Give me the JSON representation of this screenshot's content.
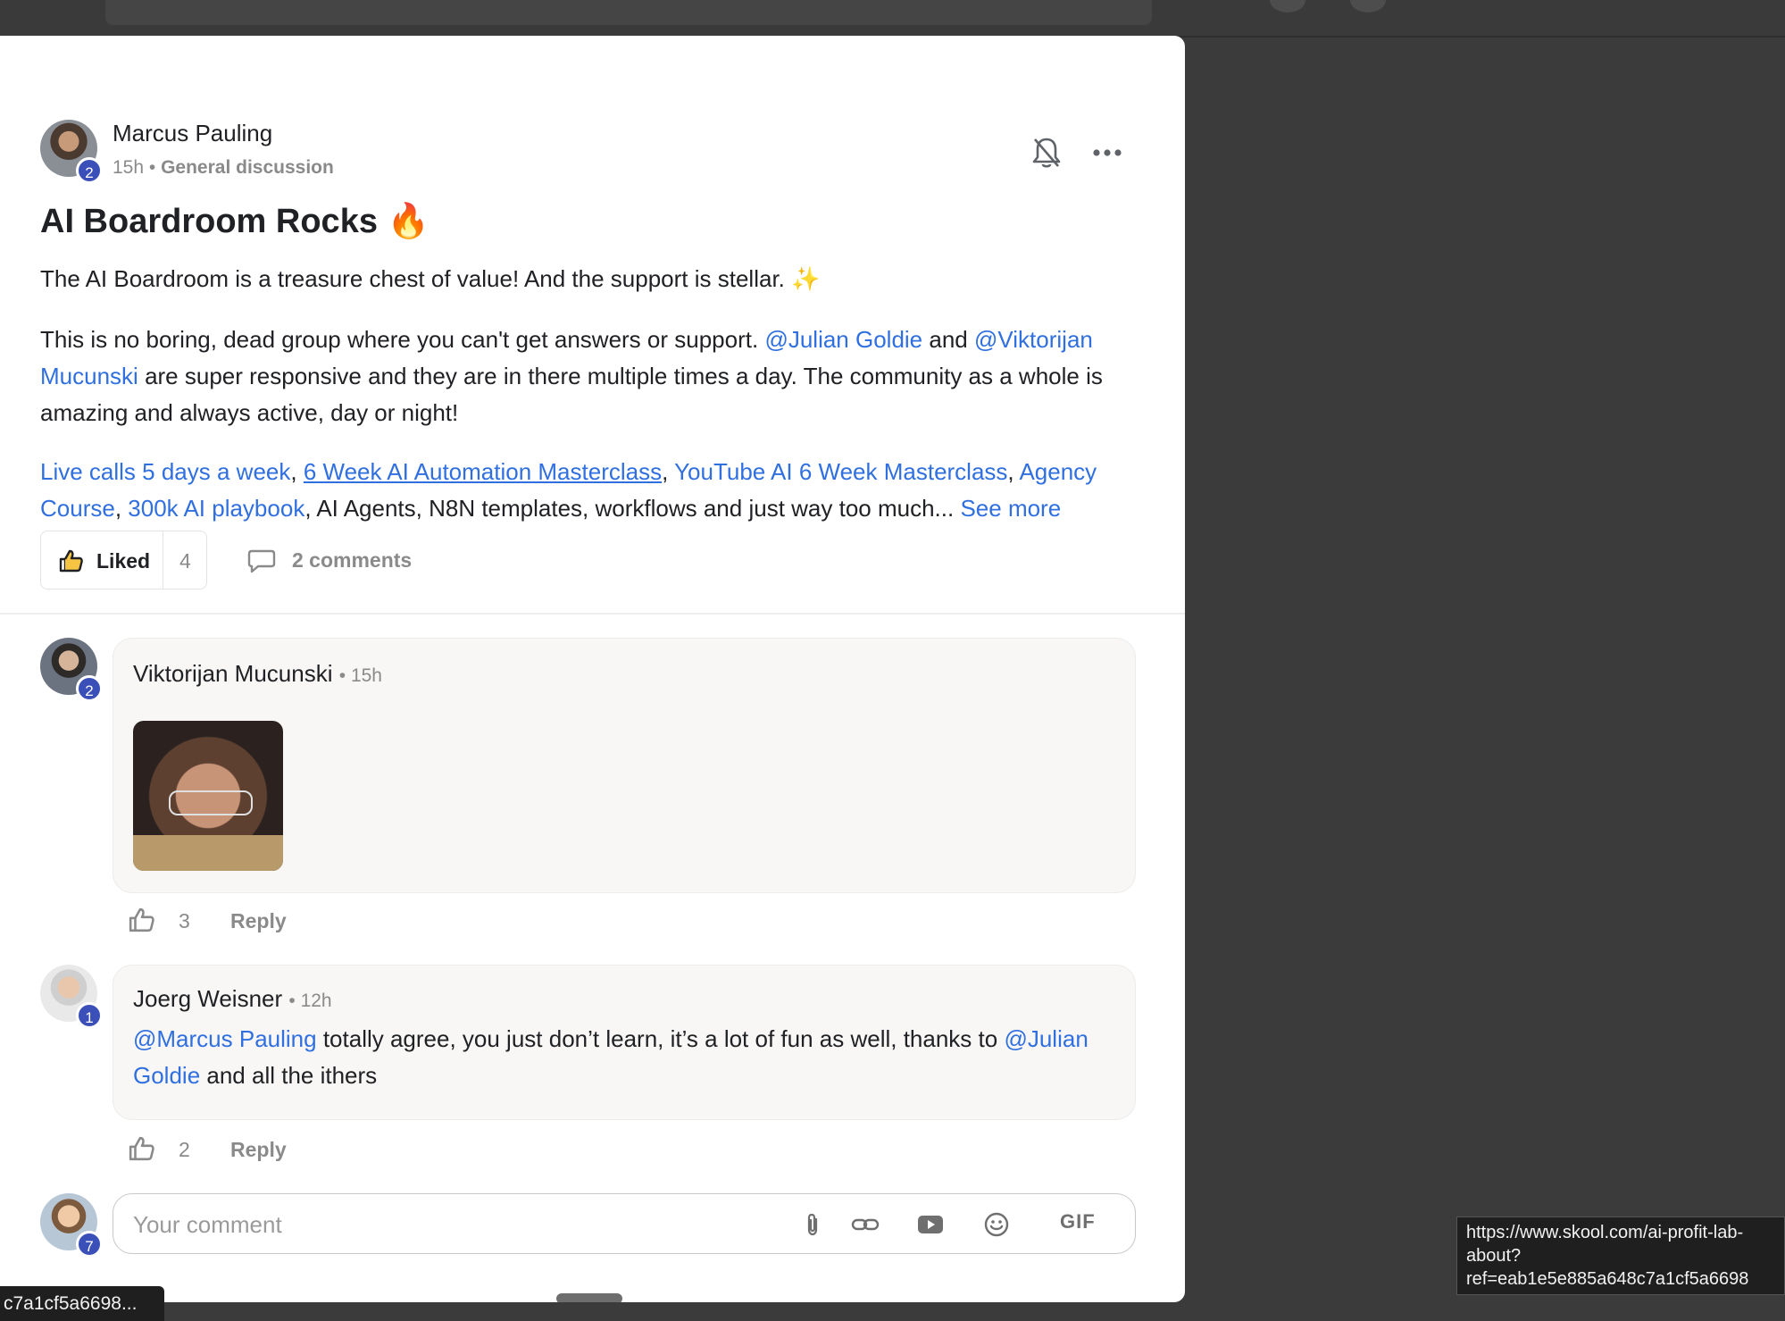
{
  "post": {
    "author": "Marcus Pauling",
    "author_level": "2",
    "time": "15h",
    "category": "General discussion",
    "title": "AI Boardroom Rocks",
    "title_emoji": "🔥",
    "para1": "The AI Boardroom is a treasure chest of value! And the support is stellar.",
    "para1_emoji": "✨",
    "para2_a": "This is no boring, dead group where you can't get answers or support.",
    "mention_julian": "@Julian Goldie",
    "para2_b": "and",
    "mention_viktorijan": "@Viktorijan Mucunski",
    "para2_c": "are super responsive and they are in there multiple times a day. The community as a whole is amazing and always active, day or night!",
    "link1": "Live calls 5 days a week",
    "link2": "6 Week AI Automation Masterclass",
    "link3": "YouTube AI 6 Week Masterclass",
    "link4": "Agency Course",
    "link5": "300k AI playbook",
    "para3_tail": ", AI Agents, N8N templates, workflows and just way too much...",
    "see_more": "See more",
    "liked_label": "Liked",
    "like_count": "4",
    "comments_label": "2 comments"
  },
  "comments": [
    {
      "author": "Viktorijan Mucunski",
      "level": "2",
      "time": "15h",
      "likes": "3",
      "reply_label": "Reply"
    },
    {
      "author": "Joerg Weisner",
      "level": "1",
      "time": "12h",
      "mention1": "@Marcus Pauling",
      "text1": "totally agree, you just don’t learn, it’s a lot of fun as well, thanks to",
      "mention2": "@Julian Goldie",
      "text2": "and all the ithers",
      "likes": "2",
      "reply_label": "Reply"
    }
  ],
  "composer": {
    "placeholder": "Your comment",
    "user_level": "7",
    "gif_label": "GIF"
  },
  "tooltip": {
    "line1": "https://www.skool.com/ai-profit-lab-",
    "line2": "about?",
    "line3": "ref=eab1e5e885a648c7a1cf5a6698"
  },
  "status_url": "c7a1cf5a6698...",
  "icons": {
    "bell": "bell-off-icon",
    "more": "more-horizontal-icon",
    "like": "thumbs-up-icon",
    "comment": "comment-icon",
    "attach": "paperclip-icon",
    "link": "link-icon",
    "video": "youtube-icon",
    "emoji": "smiley-icon"
  },
  "colors": {
    "link": "#2f6fe0",
    "badge": "#3b4fb8",
    "muted": "#8a8a8a",
    "backdrop": "#3b3b3b"
  }
}
